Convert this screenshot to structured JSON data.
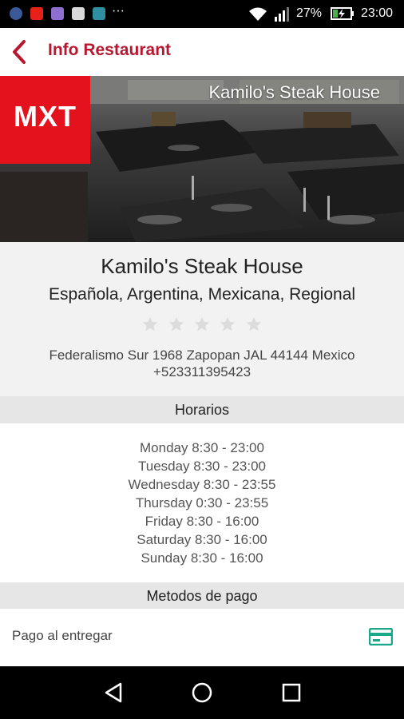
{
  "status_bar": {
    "battery_percent": "27%",
    "time": "23:00",
    "overflow": "···",
    "notification_icons": [
      "facebook-icon",
      "youtube-icon",
      "app-icon",
      "app-icon",
      "app-icon"
    ]
  },
  "app_bar": {
    "title": "Info Restaurant",
    "back_icon": "chevron-left-icon"
  },
  "hero": {
    "restaurant_name": "Kamilo's Steak House",
    "logo_text": "MXT"
  },
  "restaurant": {
    "name": "Kamilo's Steak House",
    "cuisine": "Española, Argentina, Mexicana, Regional",
    "rating": 0,
    "rating_max": 5,
    "address": "Federalismo Sur 1968 Zapopan JAL 44144 Mexico",
    "phone": "+523311395423"
  },
  "hours_section": {
    "title": "Horarios",
    "rows": [
      "Monday 8:30 - 23:00",
      "Tuesday 8:30 - 23:00",
      "Wednesday 8:30 - 23:55",
      "Thursday 0:30 - 23:55",
      "Friday 8:30 - 16:00",
      "Saturday 8:30 - 16:00",
      "Sunday 8:30 - 16:00"
    ]
  },
  "payment_section": {
    "title": "Metodos de pago",
    "method_label": "Pago al entregar",
    "method_icon": "credit-card-icon"
  },
  "colors": {
    "accent": "#b8172f",
    "logo_red": "#e4121d",
    "card_icon": "#1aa78a"
  }
}
